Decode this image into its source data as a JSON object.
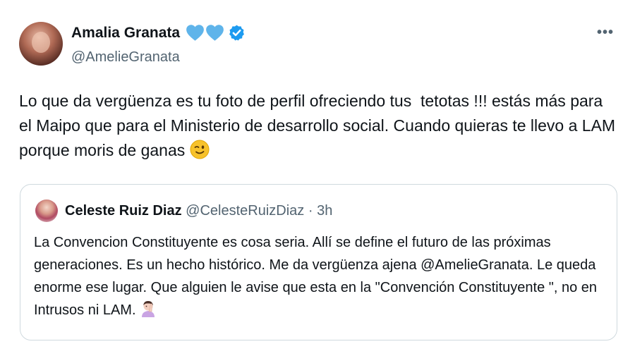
{
  "author": {
    "name": "Amalia Granata",
    "handle": "@AmelieGranata",
    "badges": [
      "blue-heart-icon",
      "blue-heart-icon",
      "verified-badge-icon"
    ]
  },
  "more_label": "•••",
  "tweet": {
    "text": "Lo que da vergüenza es tu foto de perfil ofreciendo tus  tetotas !!! estás más para el Maipo que para el Ministerio de desarrollo social. Cuando quieras te llevo a LAM porque moris de ganas ",
    "emoji": "winking-face-icon"
  },
  "quoted": {
    "name": "Celeste Ruiz Diaz",
    "meta": " @CelesteRuizDiaz · 3h",
    "text": "La Convencion Constituyente es cosa seria. Allí se define el futuro de las próximas generaciones. Es un hecho histórico. Me da vergüenza ajena @AmelieGranata.  Le queda enorme ese lugar. Que alguien le avise que esta en la \"Convención Constituyente \", no en Intrusos ni LAM. ",
    "emoji": "person-facepalming-icon"
  },
  "colors": {
    "text_primary": "#0f1419",
    "text_secondary": "#536471",
    "heart_blue": "#5fb4ea",
    "verified_blue": "#1d9bf0",
    "border": "#cfd9de"
  }
}
